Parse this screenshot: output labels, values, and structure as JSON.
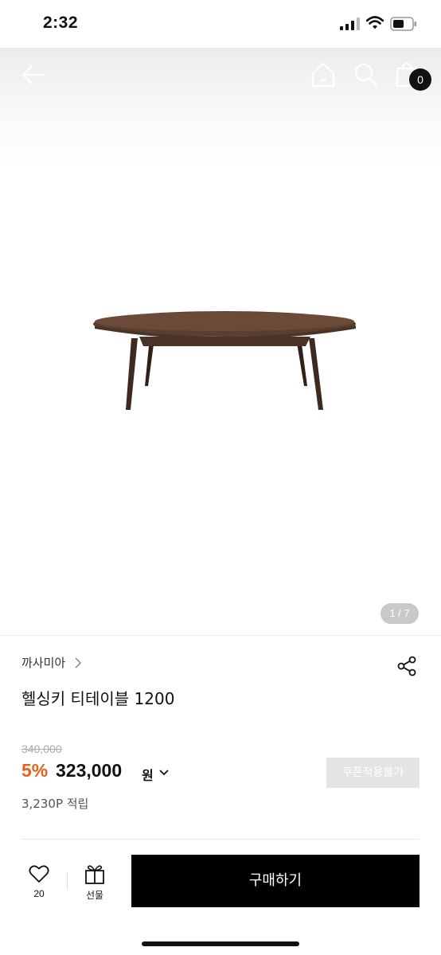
{
  "status_bar": {
    "time": "2:32"
  },
  "header": {
    "cart_count": "0"
  },
  "gallery": {
    "page_indicator": "1 / 7"
  },
  "product": {
    "brand": "까사미아",
    "title": "헬싱키 티테이블 1200",
    "original_price": "340,000",
    "discount_rate": "5%",
    "sale_price": "323,000",
    "currency": "원",
    "points": "3,230P 적립"
  },
  "coupon_button_label": "쿠폰적용불가",
  "bottom_bar": {
    "wish_count": "20",
    "gift_label": "선물",
    "buy_label": "구매하기"
  },
  "colors": {
    "discount": "#e2601d",
    "buy_button": "#000000",
    "coupon_disabled": "#e4e4e4"
  },
  "icons": [
    "back-arrow-icon",
    "home-icon",
    "search-icon",
    "shopping-bag-icon",
    "chevron-right-icon",
    "share-icon",
    "chevron-down-icon",
    "heart-icon",
    "gift-icon"
  ]
}
